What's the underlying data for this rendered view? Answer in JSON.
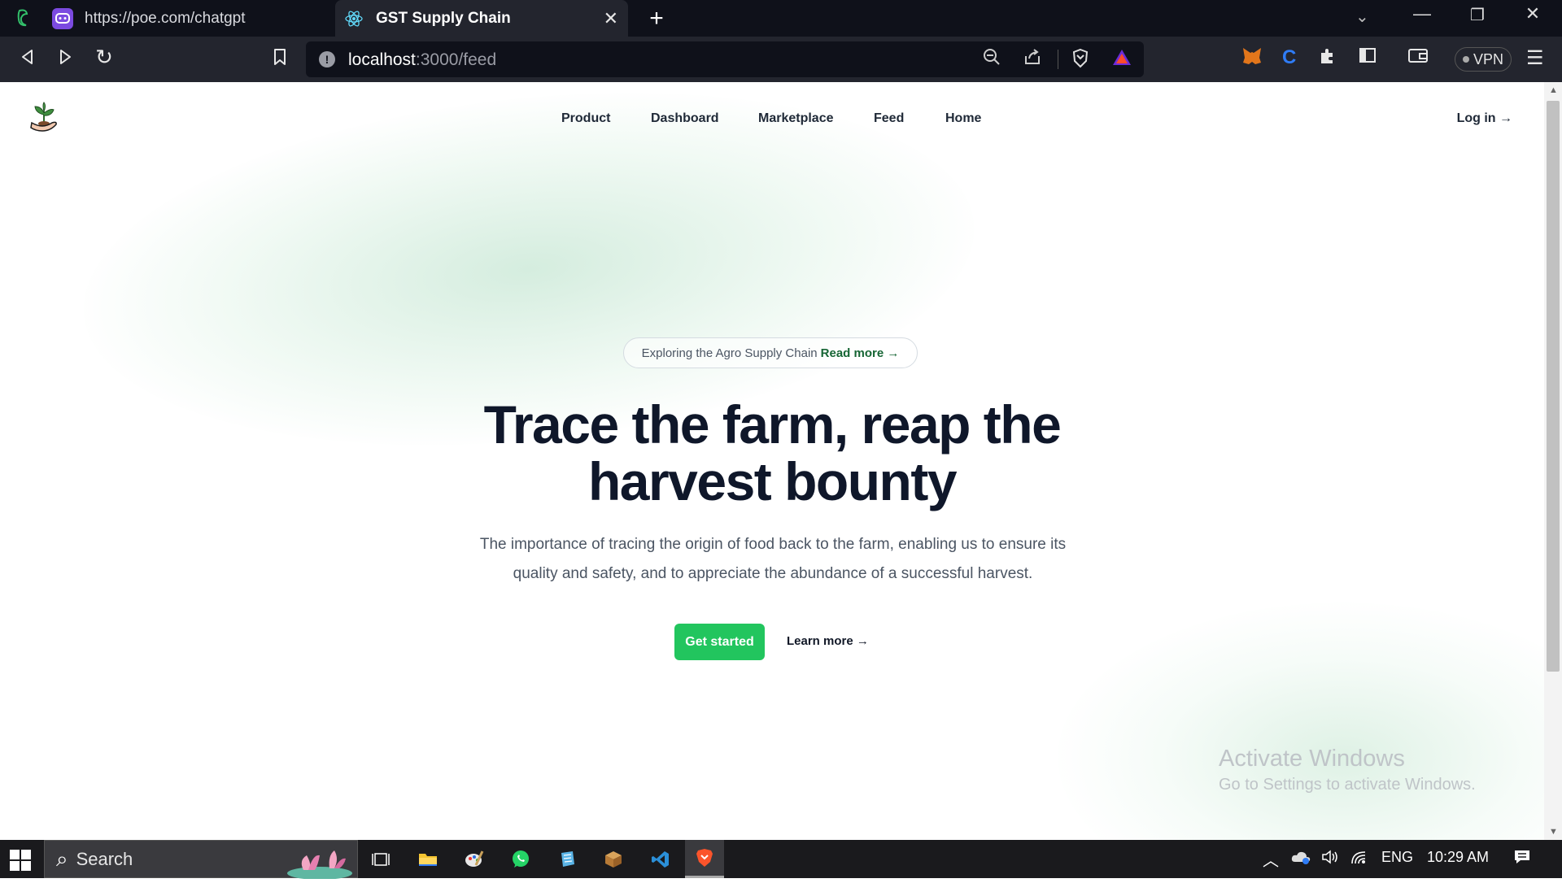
{
  "browser": {
    "tabs": [
      {
        "title": "https://poe.com/chatgpt",
        "active": false
      },
      {
        "title": "GST Supply Chain",
        "active": true
      }
    ],
    "new_tab": "+",
    "url": {
      "host": "localhost",
      "path": ":3000/feed"
    },
    "vpn_label": "VPN"
  },
  "site": {
    "nav": [
      "Product",
      "Dashboard",
      "Marketplace",
      "Feed",
      "Home"
    ],
    "login": "Log in →",
    "pill": {
      "text": "Exploring the Agro Supply Chain",
      "link": "Read more →"
    },
    "hero": {
      "title_line1": "Trace the farm, reap the",
      "title_line2": "harvest bounty",
      "subtitle": "The importance of tracing the origin of food back to the farm, enabling us to ensure its quality and safety, and to appreciate the abundance of a successful harvest."
    },
    "cta_primary": "Get started",
    "cta_secondary": "Learn more →",
    "accent_color": "#22c55e"
  },
  "watermark": {
    "title": "Activate Windows",
    "subtitle": "Go to Settings to activate Windows."
  },
  "taskbar": {
    "search_placeholder": "Search",
    "language": "ENG",
    "time": "10:29 AM"
  }
}
